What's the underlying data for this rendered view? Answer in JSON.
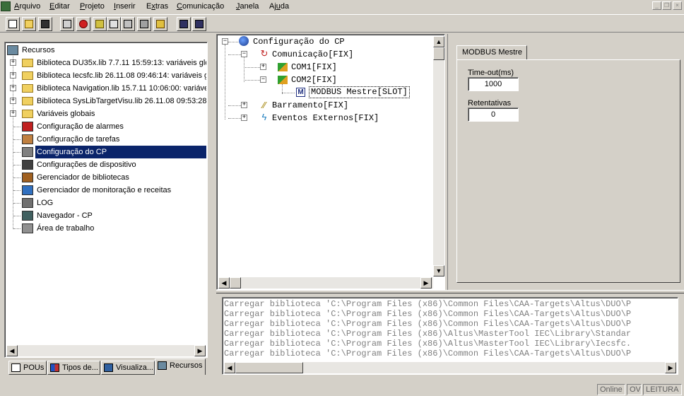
{
  "menu": [
    {
      "label": "Arquivo",
      "u": "A"
    },
    {
      "label": "Editar",
      "u": "E"
    },
    {
      "label": "Projeto",
      "u": "P"
    },
    {
      "label": "Inserir",
      "u": "I"
    },
    {
      "label": "Extras",
      "u": "x"
    },
    {
      "label": "Comunicação",
      "u": "C"
    },
    {
      "label": "Janela",
      "u": "J"
    },
    {
      "label": "Ajuda",
      "u": "u"
    }
  ],
  "window_buttons": {
    "minimize": "_",
    "restore": "❐",
    "close": "×"
  },
  "resources_tree": {
    "root": "Recursos",
    "items": [
      {
        "label": "Biblioteca DU35x.lib 7.7.11 15:59:13: variáveis glol",
        "icon": "folder-icon",
        "expandable": true
      },
      {
        "label": "Biblioteca Iecsfc.lib 26.11.08 09:46:14: variáveis gl",
        "icon": "folder-icon",
        "expandable": true
      },
      {
        "label": "Biblioteca Navigation.lib 15.7.11 10:06:00: variávei",
        "icon": "folder-icon",
        "expandable": true
      },
      {
        "label": "Biblioteca SysLibTargetVisu.lib 26.11.08 09:53:28:",
        "icon": "folder-icon",
        "expandable": true
      },
      {
        "label": "Variáveis globais",
        "icon": "folder-icon",
        "expandable": true
      },
      {
        "label": "Configuração de alarmes",
        "icon": "alarm-icon",
        "expandable": false
      },
      {
        "label": "Configuração de tarefas",
        "icon": "tasks-icon",
        "expandable": false
      },
      {
        "label": "Configuração do CP",
        "icon": "plc-config-icon",
        "expandable": false,
        "selected": true
      },
      {
        "label": "Configurações de dispositivo",
        "icon": "device-icon",
        "expandable": false
      },
      {
        "label": "Gerenciador de bibliotecas",
        "icon": "library-icon",
        "expandable": false
      },
      {
        "label": "Gerenciador de monitoração e receitas",
        "icon": "magnifier-icon",
        "expandable": false
      },
      {
        "label": "LOG",
        "icon": "log-icon",
        "expandable": false
      },
      {
        "label": "Navegador - CP",
        "icon": "browser-icon",
        "expandable": false
      },
      {
        "label": "Área de trabalho",
        "icon": "tools-icon",
        "expandable": false
      }
    ]
  },
  "bottom_tabs": [
    "POUs",
    "Tipos de...",
    "Visualiza...",
    "Recursos"
  ],
  "config_tree": {
    "root": "Configuração do CP",
    "comm": "Comunicação[FIX]",
    "com1": "COM1[FIX]",
    "com2": "COM2[FIX]",
    "modbus": "MODBUS Mestre[SLOT]",
    "bus": "Barramento[FIX]",
    "events": "Eventos Externos[FIX]"
  },
  "properties": {
    "tab": "MODBUS Mestre",
    "timeout_label": "Time-out(ms)",
    "timeout_value": "1000",
    "retries_label": "Retentativas",
    "retries_value": "0"
  },
  "log": [
    "Carregar biblioteca 'C:\\Program Files (x86)\\Common Files\\CAA-Targets\\Altus\\DUO\\P",
    "Carregar biblioteca 'C:\\Program Files (x86)\\Common Files\\CAA-Targets\\Altus\\DUO\\P",
    "Carregar biblioteca 'C:\\Program Files (x86)\\Common Files\\CAA-Targets\\Altus\\DUO\\P",
    "Carregar biblioteca 'C:\\Program Files (x86)\\Altus\\MasterTool IEC\\Library\\Standar",
    "Carregar biblioteca 'C:\\Program Files (x86)\\Altus\\MasterTool IEC\\Library\\Iecsfc.",
    "Carregar biblioteca 'C:\\Program Files (x86)\\Common Files\\CAA-Targets\\Altus\\DUO\\P"
  ],
  "status": {
    "online": "Online",
    "ov": "OV",
    "mode": "LEITURA"
  },
  "colors": {
    "selection": "#0a246a",
    "face": "#d4d0c8"
  }
}
